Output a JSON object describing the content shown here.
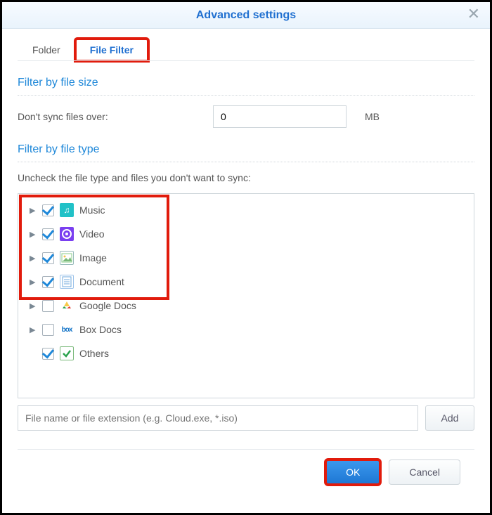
{
  "title": "Advanced settings",
  "tabs": {
    "folder": "Folder",
    "fileFilter": "File Filter"
  },
  "sizeSection": {
    "title": "Filter by file size",
    "label": "Don't sync files over:",
    "value": "0",
    "unit": "MB"
  },
  "typeSection": {
    "title": "Filter by file type",
    "hint": "Uncheck the file type and files you don't want to sync:"
  },
  "tree": {
    "items": [
      {
        "label": "Music",
        "checked": true,
        "hasChildren": true,
        "icon": "music"
      },
      {
        "label": "Video",
        "checked": true,
        "hasChildren": true,
        "icon": "video"
      },
      {
        "label": "Image",
        "checked": true,
        "hasChildren": true,
        "icon": "image"
      },
      {
        "label": "Document",
        "checked": true,
        "hasChildren": true,
        "icon": "doc"
      },
      {
        "label": "Google Docs",
        "checked": false,
        "hasChildren": true,
        "icon": "gdoc"
      },
      {
        "label": "Box Docs",
        "checked": false,
        "hasChildren": true,
        "icon": "box"
      },
      {
        "label": "Others",
        "checked": true,
        "hasChildren": false,
        "icon": "other"
      }
    ]
  },
  "addRow": {
    "placeholder": "File name or file extension (e.g. Cloud.exe, *.iso)",
    "button": "Add"
  },
  "footer": {
    "ok": "OK",
    "cancel": "Cancel"
  },
  "highlight": {
    "tabFileFilter": true,
    "treeTopFour": true,
    "ok": true
  }
}
